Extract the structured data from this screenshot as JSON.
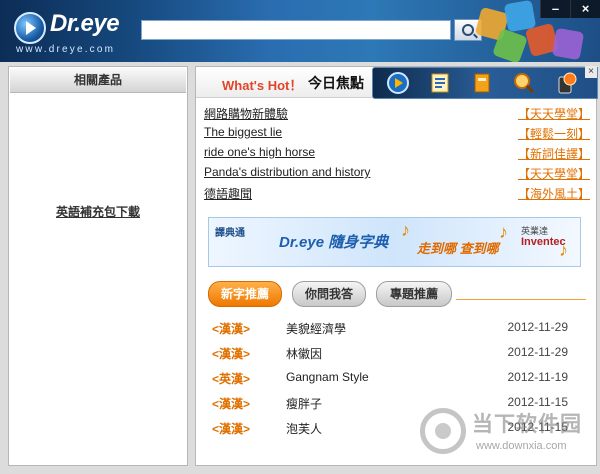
{
  "header": {
    "logo_name": "Dr.eye",
    "logo_url": "www.dreye.com",
    "search_value": "",
    "minimize_label": "–",
    "close_label": "×"
  },
  "left_panel": {
    "title": "相關產品",
    "link": "英語補充包下載"
  },
  "hot": {
    "title": "What's Hot！",
    "subtitle": "今日焦點",
    "toolbar_close": "×"
  },
  "news": [
    {
      "title": "網路購物新體驗",
      "tag": "【天天學堂】"
    },
    {
      "title": "The biggest lie",
      "tag": "【輕鬆一刻】"
    },
    {
      "title": "ride one's high horse",
      "tag": "【新詞佳譯】"
    },
    {
      "title": "Panda's distribution and history",
      "tag": "【天天學堂】"
    },
    {
      "title": "德語趣聞",
      "tag": "【海外風土】"
    }
  ],
  "banner": {
    "brand": "譯典通",
    "product": "Dr.eye 隨身字典",
    "slogan": "走到哪 查到哪",
    "partner_label": "英業達",
    "partner_name": "Inventec"
  },
  "tabs": [
    {
      "label": "新字推薦"
    },
    {
      "label": "你問我答"
    },
    {
      "label": "專題推薦"
    }
  ],
  "words": [
    {
      "tag": "<漢漢>",
      "word": "美貌經濟學",
      "date": "2012-11-29"
    },
    {
      "tag": "<漢漢>",
      "word": "林徽因",
      "date": "2012-11-29"
    },
    {
      "tag": "<英漢>",
      "word": "Gangnam Style",
      "date": "2012-11-19"
    },
    {
      "tag": "<漢漢>",
      "word": "瘦胖子",
      "date": "2012-11-15"
    },
    {
      "tag": "<漢漢>",
      "word": "泡芙人",
      "date": "2012-11-15"
    }
  ],
  "watermark": {
    "name": "当下软件园",
    "url": "www.downxia.com"
  }
}
